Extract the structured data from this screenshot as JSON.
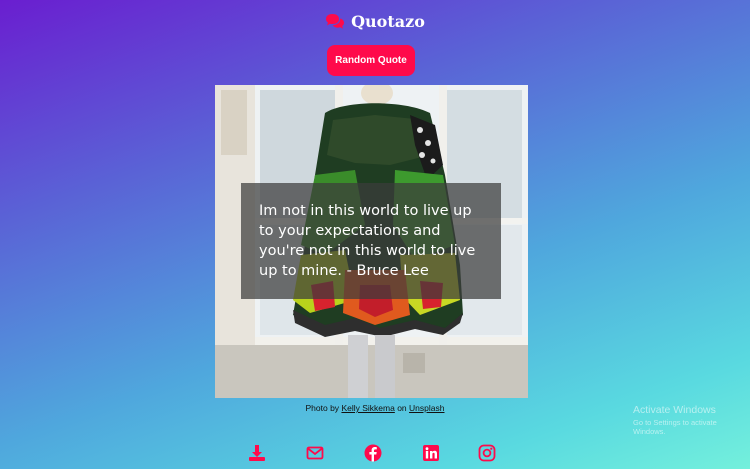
{
  "brand": {
    "name": "Quotazo",
    "icon": "comments-icon",
    "color": "#ff0a4b"
  },
  "button": {
    "label": "Random Quote"
  },
  "quote": {
    "text": "Im not in this world to live up to your expectations and you're not in this world to live up to mine. - Bruce Lee"
  },
  "credit": {
    "prefix": "Photo by",
    "author": "Kelly Sikkema",
    "middle": "on",
    "site": "Unsplash"
  },
  "social": [
    "download-icon",
    "mail-icon",
    "facebook-icon",
    "linkedin-icon",
    "instagram-icon"
  ],
  "watermark": {
    "line1": "Activate Windows",
    "line2": "Go to Settings to activate Windows."
  },
  "colors": {
    "accent": "#ff0a4b"
  }
}
